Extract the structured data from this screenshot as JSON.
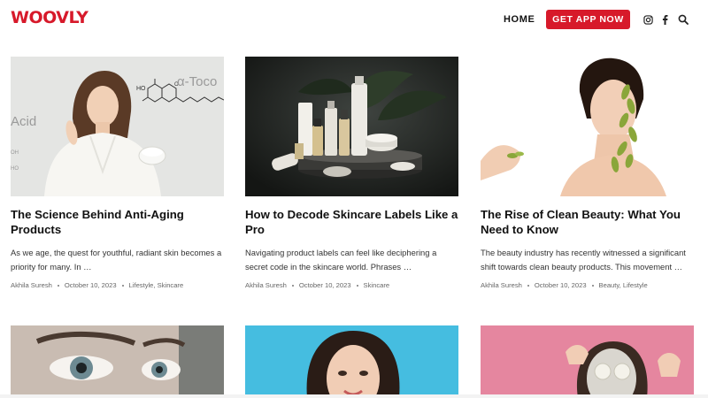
{
  "header": {
    "logo": "WOOVLY",
    "nav_home": "HOME",
    "cta": "GET APP NOW",
    "icons": [
      "instagram-icon",
      "facebook-icon",
      "search-icon"
    ]
  },
  "colors": {
    "accent": "#d7192a"
  },
  "posts": [
    {
      "title": "The Science Behind Anti-Aging Products",
      "excerpt": "As we age, the quest for youthful, radiant skin becomes a priority for many. In …",
      "author": "Akhila Suresh",
      "date": "October 10, 2023",
      "cat1": "Lifestyle",
      "cat_sep": ", ",
      "cat2": "Skincare",
      "img_text_1": "α-Toco",
      "img_text_2": "Acid",
      "img_text_3": "O",
      "img_text_4": "HO"
    },
    {
      "title": "How to Decode Skincare Labels Like a Pro",
      "excerpt": "Navigating product labels can feel like deciphering a secret code in the skincare world. Phrases …",
      "author": "Akhila Suresh",
      "date": "October 10, 2023",
      "cat1": "Skincare"
    },
    {
      "title": "The Rise of Clean Beauty: What You Need to Know",
      "excerpt": "The beauty industry has recently witnessed a significant shift towards clean beauty products. This movement …",
      "author": "Akhila Suresh",
      "date": "October 10, 2023",
      "cat1": "Beauty",
      "cat_sep": ", ",
      "cat2": "Lifestyle"
    }
  ]
}
